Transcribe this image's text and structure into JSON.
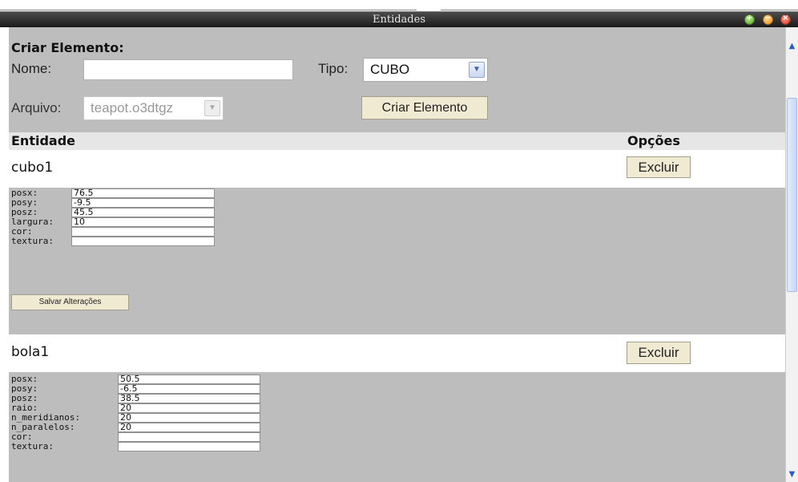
{
  "window": {
    "title": "Entidades"
  },
  "form": {
    "heading": "Criar Elemento:",
    "nome_label": "Nome:",
    "nome_value": "",
    "tipo_label": "Tipo:",
    "tipo_value": "CUBO",
    "arquivo_label": "Arquivo:",
    "arquivo_value": "teapot.o3dtgz",
    "create_button": "Criar Elemento"
  },
  "table": {
    "col_entity": "Entidade",
    "col_options": "Opções"
  },
  "entities": [
    {
      "name": "cubo1",
      "delete_label": "Excluir",
      "properties": [
        {
          "label": "posx:",
          "value": "76.5"
        },
        {
          "label": "posy:",
          "value": "-9.5"
        },
        {
          "label": "posz:",
          "value": "45.5"
        },
        {
          "label": "largura:",
          "value": "10"
        },
        {
          "label": "cor:",
          "value": ""
        },
        {
          "label": "textura:",
          "value": ""
        }
      ],
      "save_label": "Salvar Alterações"
    },
    {
      "name": "bola1",
      "delete_label": "Excluir",
      "properties": [
        {
          "label": "posx:",
          "value": "50.5"
        },
        {
          "label": "posy:",
          "value": "-6.5"
        },
        {
          "label": "posz:",
          "value": "38.5"
        },
        {
          "label": "raio:",
          "value": "20"
        },
        {
          "label": "n_meridianos:",
          "value": "20"
        },
        {
          "label": "n_paralelos:",
          "value": "20"
        },
        {
          "label": "cor:",
          "value": ""
        },
        {
          "label": "textura:",
          "value": ""
        }
      ]
    }
  ],
  "icons": {
    "window_buttons": [
      "maximize-icon",
      "minimize-icon",
      "close-icon"
    ],
    "dropdown": "chevron-down-icon",
    "scroll_up": "arrow-up-icon",
    "scroll_down": "arrow-down-icon"
  },
  "colors": {
    "titlebar": "#2a2a2a",
    "content_bg": "#bdbdbd",
    "header_row": "#e6e6e6",
    "button_bg": "#f0ead3"
  }
}
